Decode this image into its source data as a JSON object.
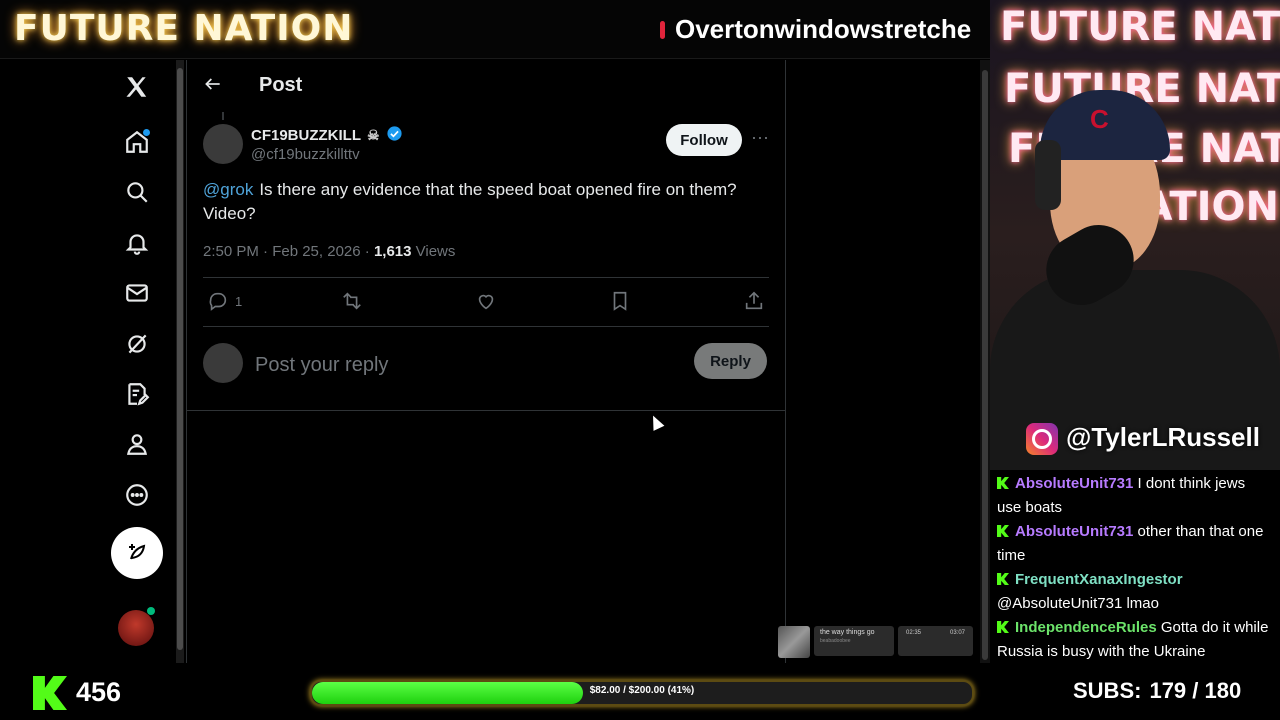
{
  "stream": {
    "logo": "FUTURE NATION",
    "ticker": "Overtonwindowstretche",
    "ig_handle": "@TylerLRussell",
    "viewer_count": "456",
    "goal_text": "$82.00 / $200.00 (41%)",
    "goal_fraction": 0.41,
    "subs_label": "SUBS:",
    "subs_value": "179 / 180",
    "neon_lines": [
      "FUTURE NATION",
      "FUTURE NATION",
      "FUTURE NATION",
      "NATION"
    ],
    "cap_logo": "C"
  },
  "sidebar": {
    "items": [
      {
        "icon": "x-logo-icon"
      },
      {
        "icon": "home-icon"
      },
      {
        "icon": "search-icon"
      },
      {
        "icon": "bell-icon"
      },
      {
        "icon": "mail-icon"
      },
      {
        "icon": "grok-icon"
      },
      {
        "icon": "edit-list-icon"
      },
      {
        "icon": "profile-icon"
      },
      {
        "icon": "more-icon"
      }
    ]
  },
  "post": {
    "header_title": "Post",
    "author_name": "CF19BUZZKILL",
    "author_emoji": "☠",
    "author_handle": "@cf19buzzkillttv",
    "follow_label": "Follow",
    "more_label": "···",
    "mention": "@grok",
    "text": "Is there any evidence that the speed boat opened fire on them? Video?",
    "time": "2:50 PM · Feb 25, 2026 · ",
    "views_count": "1,613",
    "views_label": " Views",
    "reply_count": "1",
    "reply_placeholder": "Post your reply",
    "reply_button": "Reply"
  },
  "music": {
    "title": "the way things go",
    "artist": "beabadoobee",
    "elapsed": "02:35",
    "total": "03:07"
  },
  "chat": [
    {
      "user": "AbsoluteUnit731",
      "text": "I dont think jews use boats",
      "color": "purple"
    },
    {
      "user": "AbsoluteUnit731",
      "text": "other than that one time",
      "color": "purple"
    },
    {
      "user": "FrequentXanaxIngestor",
      "text": "@AbsoluteUnit731 lmao",
      "color": "teal"
    },
    {
      "user": "IndependenceRules",
      "text": "Gotta do it while Russia is busy with the Ukraine",
      "color": "green"
    }
  ],
  "colors": {
    "accent": "#1d9bf0",
    "kick_green": "#53fc18",
    "background": "#000000"
  }
}
